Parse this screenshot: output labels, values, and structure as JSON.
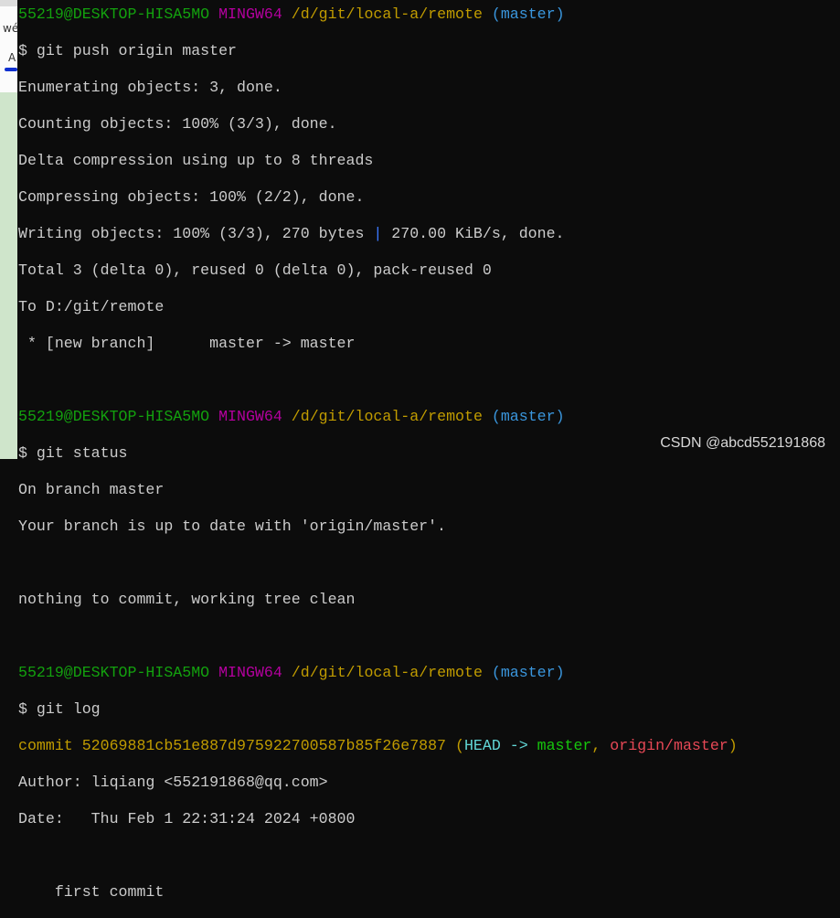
{
  "prompt": {
    "user": "55219@DESKTOP-HISA5MO",
    "system": "MINGW64",
    "path": "/d/git/local-a/remote",
    "branch": "(master)"
  },
  "lines": {
    "cmd_push": "$ git push origin master",
    "enum": "Enumerating objects: 3, done.",
    "count": "Counting objects: 100% (3/3), done.",
    "delta": "Delta compression using up to 8 threads",
    "compress": "Compressing objects: 100% (2/2), done.",
    "write_a": "Writing objects: 100% (3/3), 270 bytes ",
    "write_sep": "|",
    "write_b": " 270.00 KiB/s, done.",
    "total": "Total 3 (delta 0), reused 0 (delta 0), pack-reused 0",
    "to": "To D:/git/remote",
    "newbranch": " * [new branch]      master -> master",
    "cmd_status": "$ git status",
    "onbranch": "On branch master",
    "uptodate": "Your branch is up to date with 'origin/master'.",
    "clean": "nothing to commit, working tree clean",
    "cmd_log": "$ git log",
    "commit": "commit 52069881cb51e887d975922700587b85f26e7887",
    "paren_open": " (",
    "head": "HEAD -> ",
    "master": "master",
    "comma": ", ",
    "origin": "origin/master",
    "paren_close": ")",
    "author": "Author: liqiang <552191868@qq.com>",
    "date": "Date:   Thu Feb 1 22:31:24 2024 +0800",
    "message": "    first commit"
  },
  "left_panel": {
    "glyph1": "wé",
    "glyph2": "A"
  },
  "watermark": "CSDN @abcd552191868"
}
